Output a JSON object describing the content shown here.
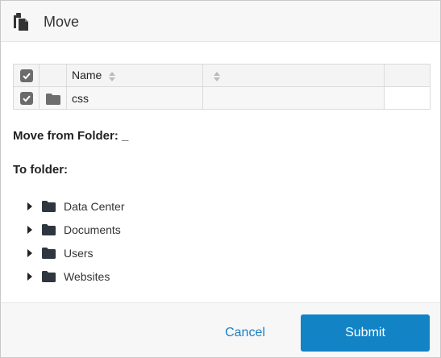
{
  "dialog": {
    "title": "Move",
    "icon": "copy-files-icon"
  },
  "table": {
    "columns": [
      {
        "label": "",
        "type": "checkbox",
        "checked": true
      },
      {
        "label": "",
        "type": "icon"
      },
      {
        "label": "Name",
        "sortable": true
      },
      {
        "label": "",
        "sortable": true
      },
      {
        "label": ""
      }
    ],
    "rows": [
      {
        "checked": true,
        "icon": "folder-icon",
        "name": "css"
      }
    ]
  },
  "move_from": {
    "label": "Move from Folder: _"
  },
  "to_folder": {
    "label": "To folder:"
  },
  "tree": {
    "items": [
      {
        "label": "Data Center",
        "icon": "folder-icon",
        "expandable": true
      },
      {
        "label": "Documents",
        "icon": "folder-icon",
        "expandable": true
      },
      {
        "label": "Users",
        "icon": "folder-icon",
        "expandable": true
      },
      {
        "label": "Websites",
        "icon": "folder-icon",
        "expandable": true
      }
    ]
  },
  "footer": {
    "cancel_label": "Cancel",
    "submit_label": "Submit"
  },
  "colors": {
    "accent": "#1284c6",
    "link": "#1a7fc1",
    "checkbox": "#6b6b6b",
    "folder_dark": "#2f3640",
    "folder_gray": "#6d6d6d"
  }
}
